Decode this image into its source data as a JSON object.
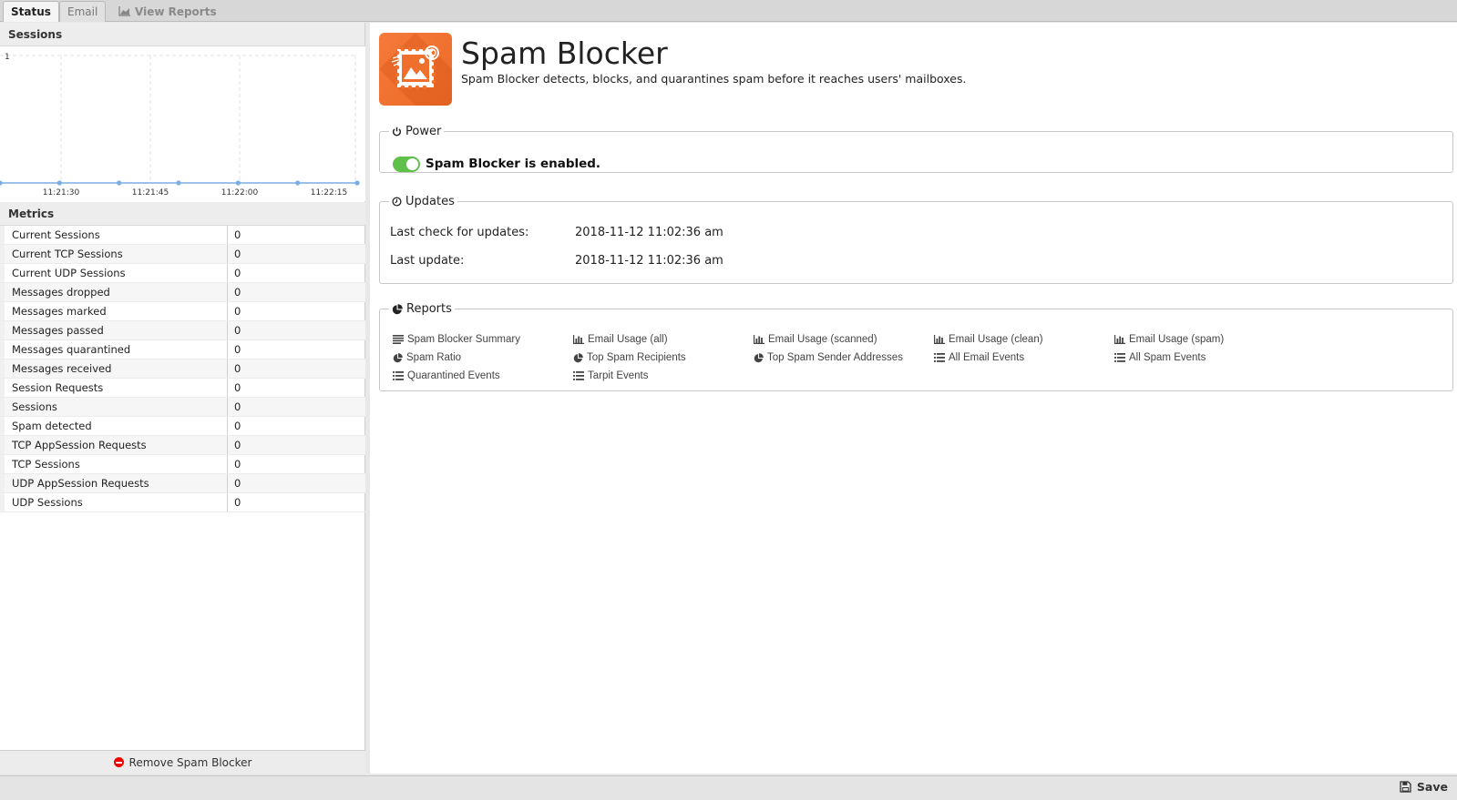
{
  "tabs": [
    {
      "label": "Status"
    },
    {
      "label": "Email"
    },
    {
      "label": "View Reports"
    }
  ],
  "sessions": {
    "header": "Sessions",
    "chart_data": {
      "type": "line",
      "x": [
        "11:21:30",
        "11:21:45",
        "11:22:00",
        "11:22:15"
      ],
      "series": [
        {
          "values": [
            0,
            0,
            0,
            0,
            0,
            0,
            0
          ]
        }
      ],
      "ylim": [
        0,
        1
      ],
      "yticks": [
        "1"
      ],
      "grid": true
    }
  },
  "metrics": {
    "header": "Metrics",
    "rows": [
      {
        "name": "Current Sessions",
        "value": "0"
      },
      {
        "name": "Current TCP Sessions",
        "value": "0"
      },
      {
        "name": "Current UDP Sessions",
        "value": "0"
      },
      {
        "name": "Messages dropped",
        "value": "0"
      },
      {
        "name": "Messages marked",
        "value": "0"
      },
      {
        "name": "Messages passed",
        "value": "0"
      },
      {
        "name": "Messages quarantined",
        "value": "0"
      },
      {
        "name": "Messages received",
        "value": "0"
      },
      {
        "name": "Session Requests",
        "value": "0"
      },
      {
        "name": "Sessions",
        "value": "0"
      },
      {
        "name": "Spam detected",
        "value": "0"
      },
      {
        "name": "TCP AppSession Requests",
        "value": "0"
      },
      {
        "name": "TCP Sessions",
        "value": "0"
      },
      {
        "name": "UDP AppSession Requests",
        "value": "0"
      },
      {
        "name": "UDP Sessions",
        "value": "0"
      }
    ]
  },
  "remove_label": "Remove Spam Blocker",
  "app": {
    "title": "Spam Blocker",
    "description": "Spam Blocker detects, blocks, and quarantines spam before it reaches users' mailboxes.",
    "accent": "#ef6f2c"
  },
  "power": {
    "legend": "Power",
    "status": "Spam Blocker is enabled.",
    "enabled": true,
    "toggle_color": "#5fc04a"
  },
  "updates": {
    "legend": "Updates",
    "last_check_label": "Last check for updates:",
    "last_check_value": "2018-11-12 11:02:36 am",
    "last_update_label": "Last update:",
    "last_update_value": "2018-11-12 11:02:36 am"
  },
  "reports": {
    "legend": "Reports",
    "links": [
      {
        "label": "Spam Blocker Summary",
        "icon": "text-icon"
      },
      {
        "label": "Email Usage (all)",
        "icon": "bar-chart-icon"
      },
      {
        "label": "Email Usage (scanned)",
        "icon": "bar-chart-icon"
      },
      {
        "label": "Email Usage (clean)",
        "icon": "bar-chart-icon"
      },
      {
        "label": "Email Usage (spam)",
        "icon": "bar-chart-icon"
      },
      {
        "label": "Spam Ratio",
        "icon": "pie-chart-icon"
      },
      {
        "label": "Top Spam Recipients",
        "icon": "pie-chart-icon"
      },
      {
        "label": "Top Spam Sender Addresses",
        "icon": "pie-chart-icon"
      },
      {
        "label": "All Email Events",
        "icon": "list-icon"
      },
      {
        "label": "All Spam Events",
        "icon": "list-icon"
      },
      {
        "label": "Quarantined Events",
        "icon": "list-icon"
      },
      {
        "label": "Tarpit Events",
        "icon": "list-icon"
      }
    ]
  },
  "save_label": "Save"
}
